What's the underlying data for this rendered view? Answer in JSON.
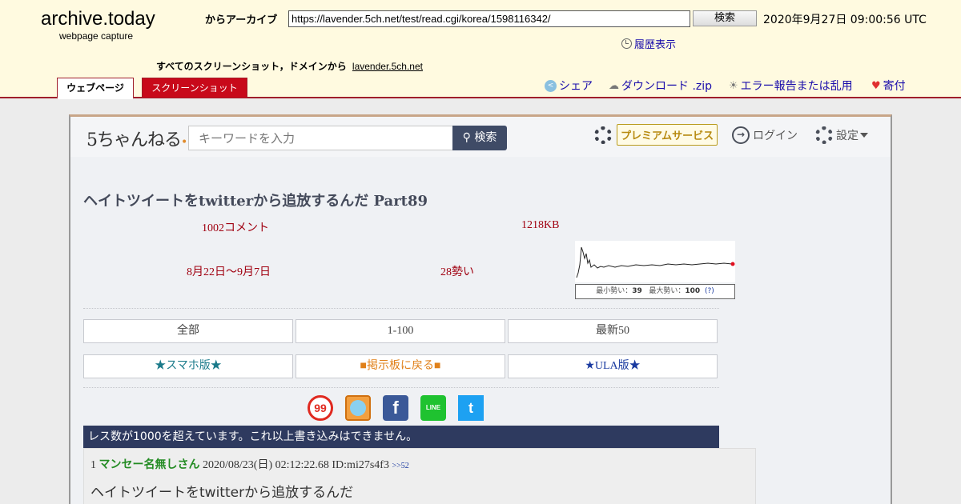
{
  "archive": {
    "logo": "archive.today",
    "subtitle": "webpage capture",
    "from_label": "からアーカイブ",
    "url_value": "https://lavender.5ch.net/test/read.cgi/korea/1598116342/",
    "search_button": "検索",
    "timestamp": "2020年9月27日 09:00:56 UTC",
    "history_link": "履歴表示",
    "all_screenshots": "すべてのスクリーンショット，ドメインから",
    "domain_link": "lavender.5ch.net",
    "tabs": [
      {
        "label": "ウェブページ",
        "active": true
      },
      {
        "label": "スクリーンショット",
        "active": false
      }
    ],
    "tools": [
      {
        "label": "シェア",
        "icon": "share-icon"
      },
      {
        "label": "ダウンロード .zip",
        "icon": "download-cloud-icon"
      },
      {
        "label": "エラー報告または乱用",
        "icon": "bulb-icon"
      },
      {
        "label": "寄付",
        "icon": "heart-icon"
      }
    ]
  },
  "site": {
    "logo": "5ちゃんねる",
    "search_placeholder": "キーワードを入力",
    "search_button": "検索",
    "premium": "プレミアムサービス",
    "login": "ログイン",
    "settings": "設定"
  },
  "thread": {
    "title": "ヘイトツイートをtwitterから追放するんだ Part89",
    "comments": "1002コメント",
    "size": "1218KB",
    "period": "8月22日〜9月7日",
    "momentum": "28勢い",
    "chart_caption_min_label": "最小勢い：",
    "chart_caption_min": "39",
    "chart_caption_max_label": "最大勢い：",
    "chart_caption_max": "100",
    "chart_caption_help": "(?)",
    "nav": [
      "全部",
      "1-100",
      "最新50"
    ],
    "links": [
      {
        "label": "★スマホ版★",
        "color": "#1a7a8a"
      },
      {
        "label": "■掲示板に戻る■",
        "color": "#e0801a"
      },
      {
        "label": "★ULA版★",
        "color": "#1a3aa0"
      }
    ],
    "social": [
      "99-icon",
      "ranking-icon",
      "facebook-icon",
      "line-icon",
      "twitter-icon"
    ],
    "social_text": {
      "s99": "99",
      "facebook": "f",
      "line": "LINE",
      "twitter": "t"
    },
    "notice": "レス数が1000を超えています。これ以上書き込みはできません。"
  },
  "post": {
    "number": "1",
    "name": "マンセー名無しさん",
    "date": "2020/08/23(日) 02:12:22.68",
    "id": "ID:mi27s4f3",
    "reply": ">>52",
    "body": "ヘイトツイートをtwitterから追放するんだ"
  },
  "colors": {
    "archive_bg": "#fffae0",
    "archive_accent": "#c8091a",
    "banner": "#2e3a5f",
    "stat_red": "#a00010"
  }
}
